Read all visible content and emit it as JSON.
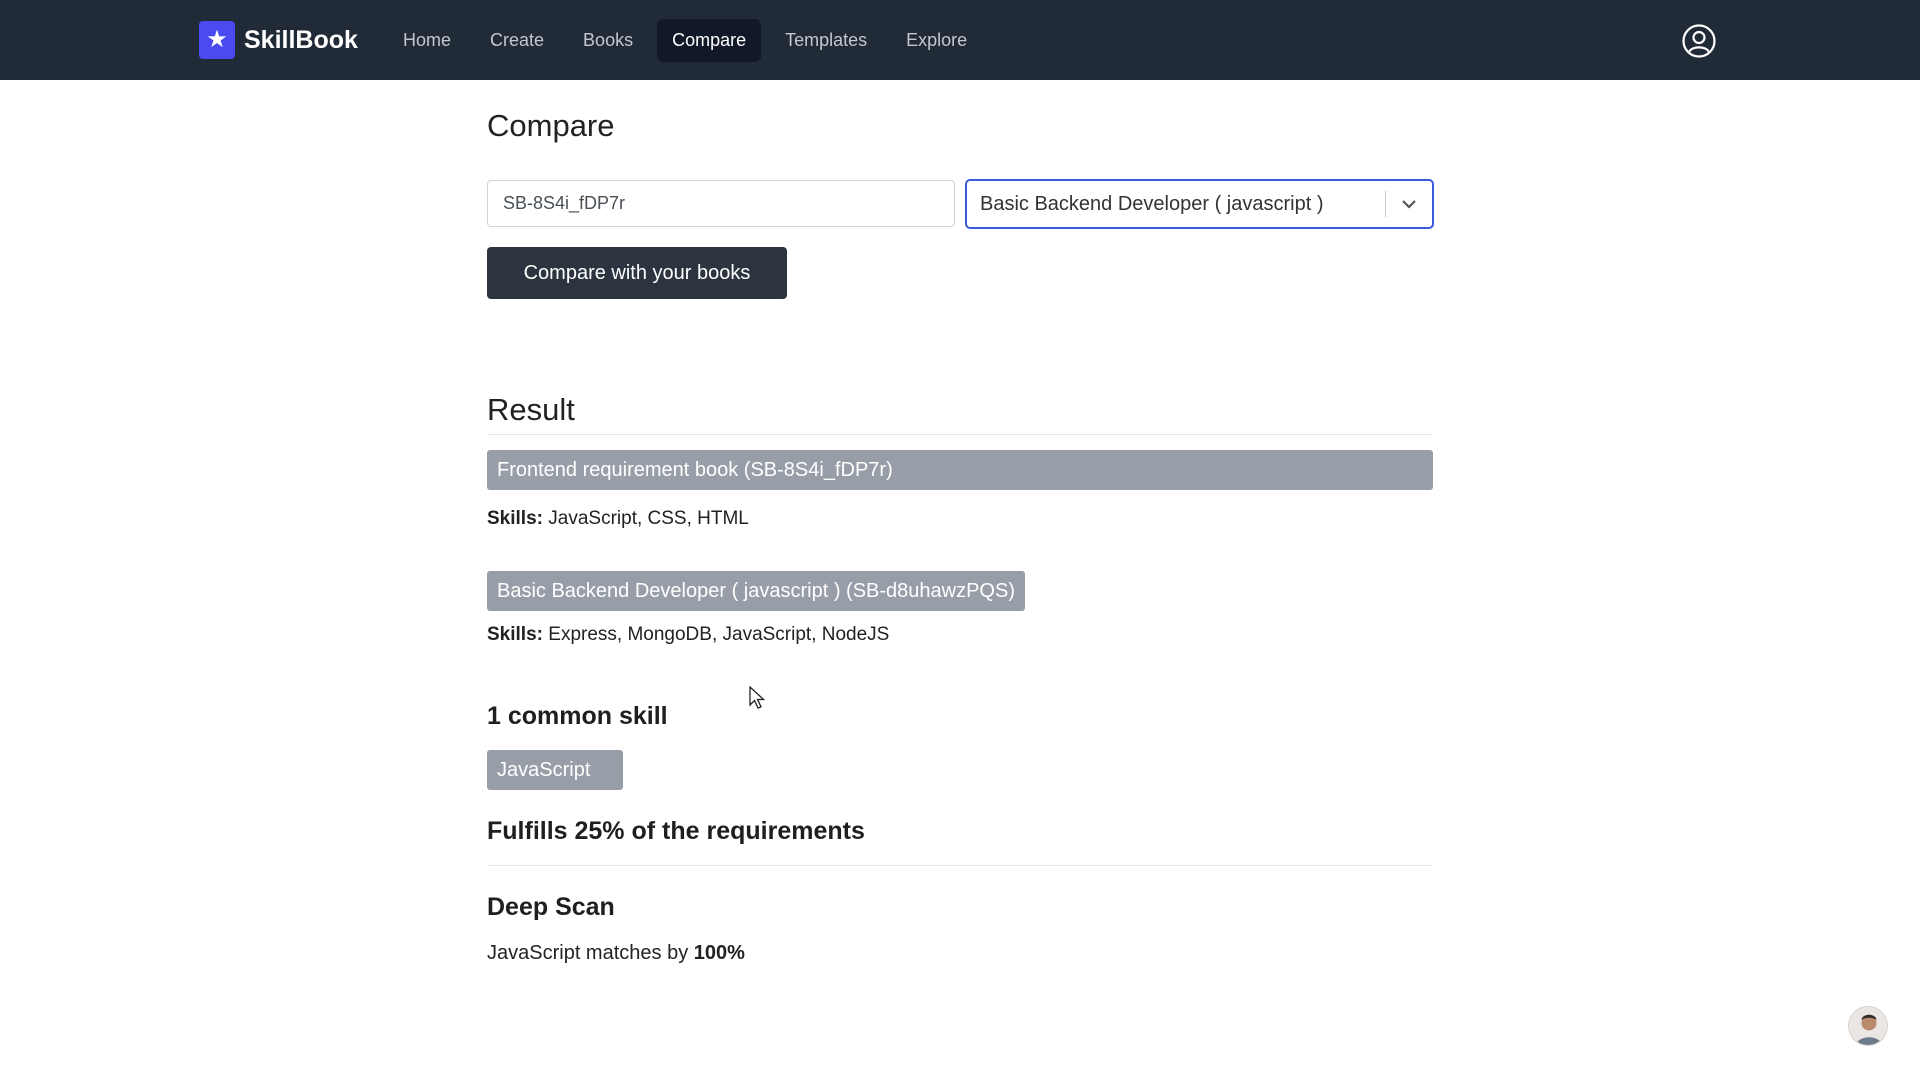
{
  "app": {
    "name": "SkillBook",
    "brand_color": "#4a4af2",
    "logo_icon": "star-icon"
  },
  "nav": {
    "items": [
      {
        "label": "Home",
        "active": false
      },
      {
        "label": "Create",
        "active": false
      },
      {
        "label": "Books",
        "active": false
      },
      {
        "label": "Compare",
        "active": true
      },
      {
        "label": "Templates",
        "active": false
      },
      {
        "label": "Explore",
        "active": false
      }
    ],
    "user_icon": "user-circle-icon"
  },
  "compare": {
    "title": "Compare",
    "book_id_value": "SB-8S4i_fDP7r",
    "selected_book": "Basic Backend Developer ( javascript )",
    "button_label": "Compare with your books"
  },
  "result": {
    "title": "Result",
    "skills_label": "Skills:",
    "books": [
      {
        "label": "Frontend requirement book (SB-8S4i_fDP7r)",
        "skills": "JavaScript, CSS, HTML"
      },
      {
        "label": "Basic Backend Developer ( javascript ) (SB-d8uhawzPQS)",
        "skills": "Express, MongoDB, JavaScript, NodeJS"
      }
    ],
    "common_heading": "1 common skill",
    "common_skills": [
      "JavaScript"
    ],
    "fulfills": "Fulfills 25% of the requirements",
    "deep_scan": {
      "title": "Deep Scan",
      "text_prefix": "JavaScript matches by ",
      "percent": "100%"
    }
  }
}
